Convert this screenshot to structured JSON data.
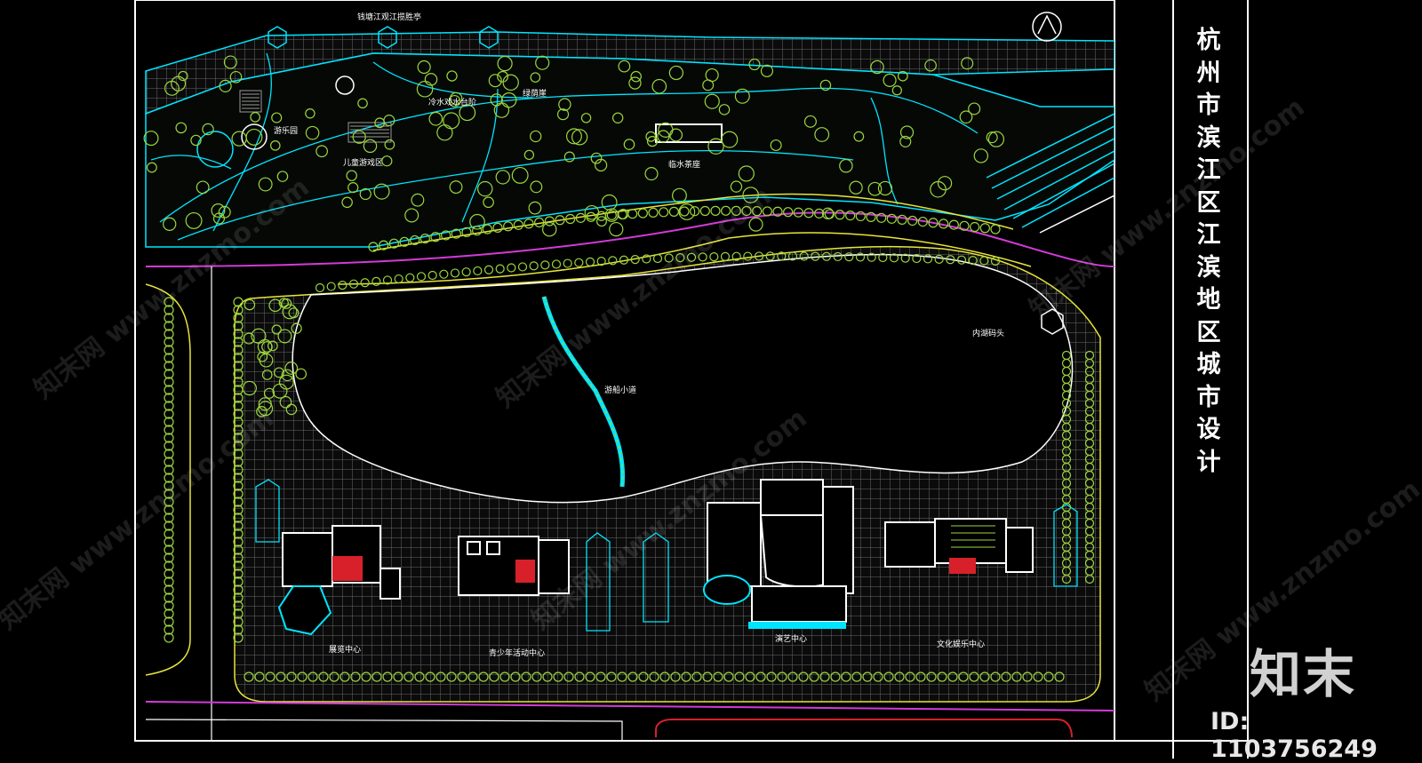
{
  "title_vertical": "杭州市滨江区江滨地区城市设计",
  "brand": "知末",
  "id_label": "ID: 1103756249",
  "watermark": "知末网 www.znzmo.com",
  "labels": {
    "pavilion": "钱塘江观江揽胜亭",
    "waterfront_steps": "冷水戏水台阶",
    "green_cliff": "绿荫崖",
    "tea_house": "临水茶座",
    "children_area": "儿童游戏区",
    "playground": "游乐园",
    "fishing_wharf": "内湖码头",
    "lake_bridge": "游船小道",
    "exhibition_center": "展览中心",
    "youth_center": "青少年活动中心",
    "theatre_center": "演艺中心",
    "culture_center": "文化娱乐中心"
  },
  "colors": {
    "cyan": "#00e5ff",
    "green": "#9bd63f",
    "yellow": "#e8e53a",
    "magenta": "#d23bd8",
    "white": "#ffffff",
    "red": "#d8202a",
    "grid": "#6a6a6a"
  }
}
